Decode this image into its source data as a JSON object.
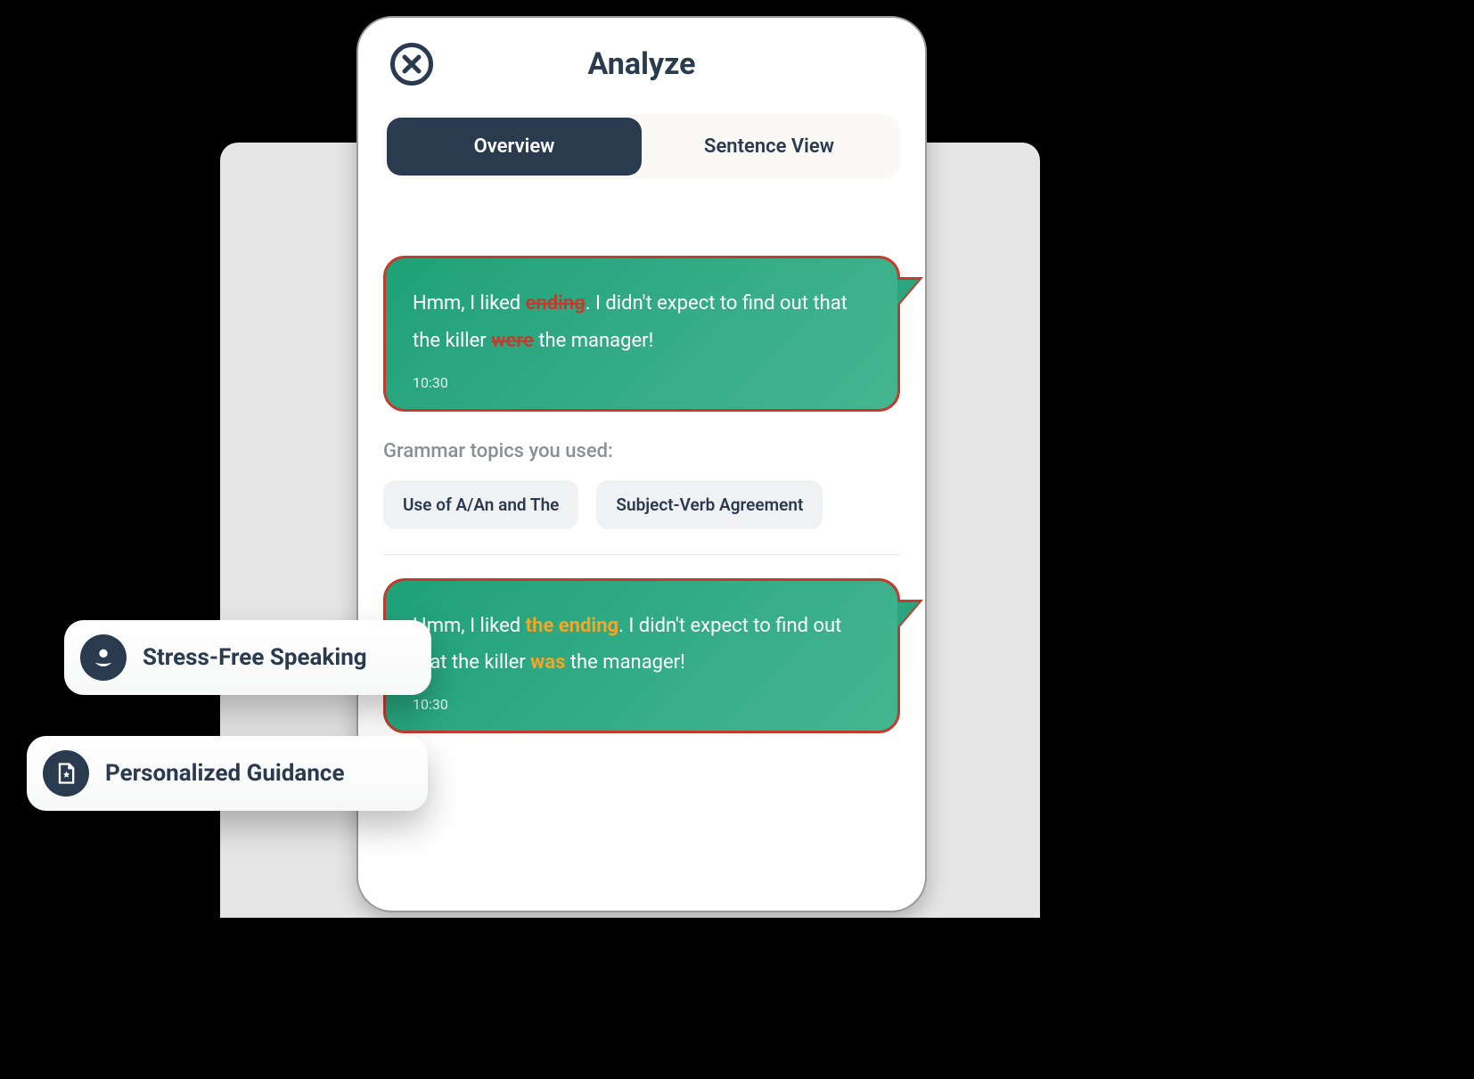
{
  "header": {
    "title": "Analyze"
  },
  "tabs": {
    "overview": "Overview",
    "sentence": "Sentence View"
  },
  "bubble1": {
    "pre1": "Hmm, I liked ",
    "err1": "ending",
    "mid1": ". I didn't expect to find out that the killer ",
    "err2": "were",
    "post1": " the manager!",
    "time": "10:30"
  },
  "grammar": {
    "label": "Grammar topics you used:",
    "chip1": "Use of A/An and The",
    "chip2": "Subject-Verb Agreement"
  },
  "bubble2": {
    "pre1": "Hmm, I liked ",
    "fix1": "the ending",
    "mid1": ". I didn't expect to find out that the killer ",
    "fix2": "was",
    "post1": " the manager!",
    "time": "10:30"
  },
  "features": {
    "one": "Stress-Free Speaking",
    "two": "Personalized Guidance"
  }
}
